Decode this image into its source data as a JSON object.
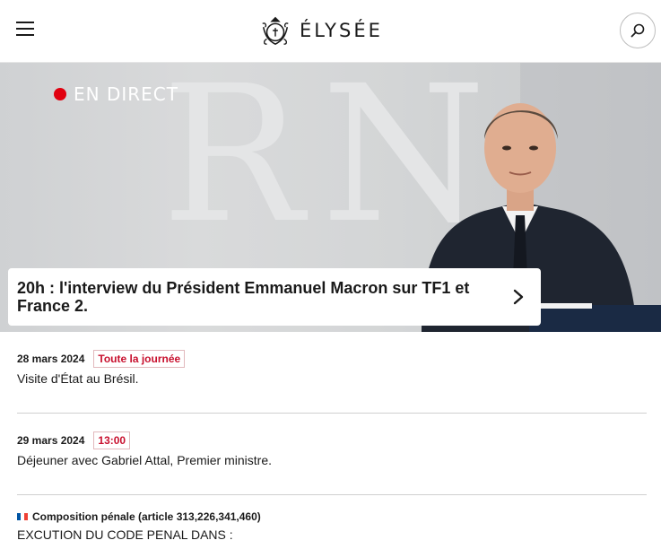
{
  "header": {
    "brand": "ÉLYSÉE",
    "menu_icon": "hamburger-menu-icon",
    "search_icon": "search-icon",
    "logo_icon": "elysee-emblem-icon"
  },
  "hero": {
    "live_label": "EN DIRECT",
    "live_color": "#e1000f",
    "title": "20h : l'interview du Président Emmanuel Macron sur TF1 et France 2.",
    "arrow_icon": "chevron-right-icon"
  },
  "agenda": [
    {
      "date": "28 mars 2024",
      "time": "Toute la journée",
      "title": "Visite d'État au Brésil."
    },
    {
      "date": "29 mars 2024",
      "time": "13:00",
      "title": "Déjeuner avec Gabriel Attal, Premier ministre."
    }
  ],
  "note": {
    "flag_icon": "french-flag-icon",
    "heading": "Composition pénale (article 313,226,341,460)",
    "body": "EXCUTION DU CODE PENAL DANS :"
  },
  "colors": {
    "accent_red": "#c8102e",
    "flag_blue": "#0055a4",
    "flag_red": "#ef4135"
  }
}
